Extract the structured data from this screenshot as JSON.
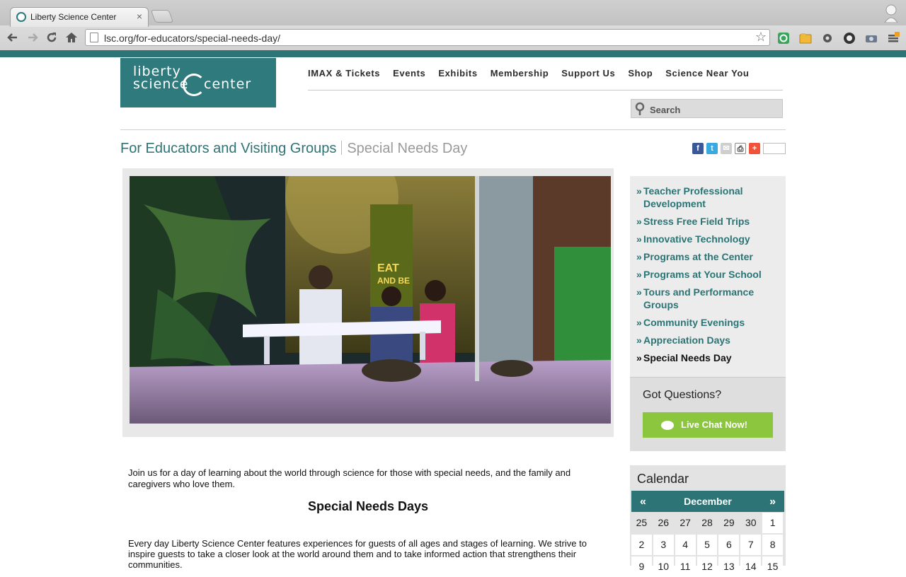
{
  "browser": {
    "tab_title": "Liberty Science Center",
    "tab_close": "×",
    "url": "lsc.org/for-educators/special-needs-day/"
  },
  "site": {
    "logo": {
      "line1": "liberty",
      "line2": "science",
      "line3": "center"
    },
    "nav": [
      "IMAX & Tickets",
      "Events",
      "Exhibits",
      "Membership",
      "Support Us",
      "Shop",
      "Science Near You"
    ],
    "search_placeholder": "Search"
  },
  "breadcrumb": {
    "section": "For Educators and Visiting Groups",
    "page": "Special Needs Day"
  },
  "share_icons": [
    "facebook-icon",
    "twitter-icon",
    "email-icon",
    "print-icon",
    "addthis-icon"
  ],
  "hero_image": {
    "sign_text_line1": "EAT",
    "sign_text_line2": "AND BE"
  },
  "content": {
    "intro": "Join us for a day of learning about the world through science for those with special needs, and the family and caregivers who love them.",
    "heading": "Special Needs Days",
    "paragraph": "Every day Liberty Science Center features experiences for guests of all ages and stages of learning. We strive to inspire guests to take a closer look at the world around them and to take informed action that strengthens their communities."
  },
  "sidebar": {
    "items": [
      {
        "label": "Teacher Professional Development",
        "active": false
      },
      {
        "label": "Stress Free Field Trips",
        "active": false
      },
      {
        "label": "Innovative Technology",
        "active": false
      },
      {
        "label": "Programs at the Center",
        "active": false
      },
      {
        "label": "Programs at Your School",
        "active": false
      },
      {
        "label": "Tours and Performance Groups",
        "active": false
      },
      {
        "label": "Community Evenings",
        "active": false
      },
      {
        "label": "Appreciation Days",
        "active": false
      },
      {
        "label": "Special Needs Day",
        "active": true
      }
    ],
    "bullet": "»",
    "questions_title": "Got Questions?",
    "chat_label": "Live Chat Now!"
  },
  "calendar": {
    "title": "Calendar",
    "month": "December",
    "prev": "«",
    "next": "»",
    "rows": [
      [
        "25",
        "26",
        "27",
        "28",
        "29",
        "30",
        "1"
      ],
      [
        "2",
        "3",
        "4",
        "5",
        "6",
        "7",
        "8"
      ],
      [
        "9",
        "10",
        "11",
        "12",
        "13",
        "14",
        "15"
      ]
    ]
  },
  "colors": {
    "brand_teal": "#2c7476",
    "chat_green": "#8cc63f",
    "sidebar_bg": "#ececec"
  }
}
